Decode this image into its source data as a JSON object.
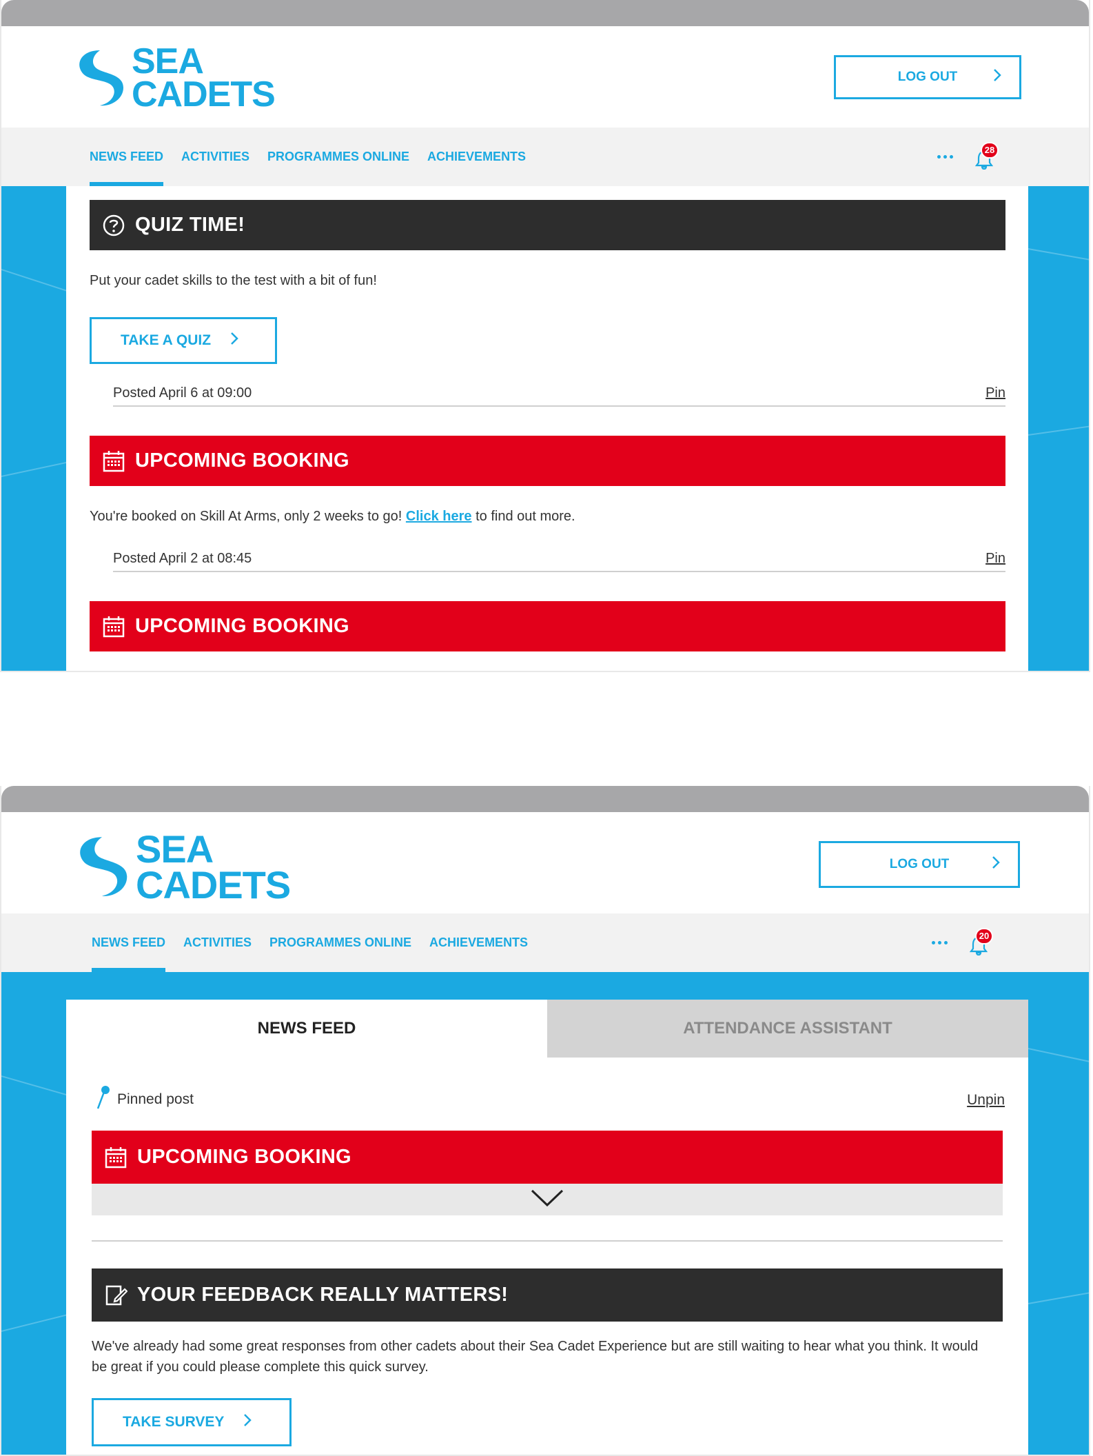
{
  "brand": {
    "line1": "SEA",
    "line2": "CADETS",
    "logo_icon": "sea-cadets-wave-logo",
    "color": "#1ba9e1"
  },
  "header": {
    "logout_label": "LOG OUT"
  },
  "nav": {
    "items": [
      {
        "label": "NEWS FEED"
      },
      {
        "label": "ACTIVITIES"
      },
      {
        "label": "PROGRAMMES ONLINE"
      },
      {
        "label": "ACHIEVEMENTS"
      }
    ],
    "more_icon": "ellipsis-icon",
    "bell_icon": "bell-icon"
  },
  "screen1": {
    "notification_count": "28",
    "quiz": {
      "title": "QUIZ TIME!",
      "icon": "question-circle-icon",
      "text": "Put your cadet skills to the test with a bit of fun!",
      "button": "TAKE A QUIZ",
      "posted": "Posted April 6 at 09:00",
      "pin": "Pin"
    },
    "booking1": {
      "title": "UPCOMING BOOKING",
      "icon": "calendar-icon",
      "text_before": "You're booked on Skill At Arms, only 2 weeks to go!",
      "link": "Click here",
      "text_after": "to find out more.",
      "posted": "Posted April 2 at 08:45",
      "pin": "Pin"
    },
    "booking2": {
      "title": "UPCOMING BOOKING",
      "icon": "calendar-icon"
    }
  },
  "screen2": {
    "notification_count": "20",
    "tabs": [
      {
        "label": "NEWS FEED"
      },
      {
        "label": "ATTENDANCE ASSISTANT"
      }
    ],
    "pinned": {
      "label": "Pinned post",
      "unpin": "Unpin",
      "icon": "pin-icon"
    },
    "booking": {
      "title": "UPCOMING BOOKING",
      "icon": "calendar-icon",
      "expand_icon": "chevron-down-icon"
    },
    "feedback": {
      "title": "YOUR FEEDBACK REALLY MATTERS!",
      "icon": "edit-form-icon",
      "text": "We've already had some great responses from other cadets about their Sea Cadet Experience but are still waiting to hear what you think. It would be great if you could please complete this quick survey.",
      "button": "TAKE SURVEY"
    }
  },
  "colors": {
    "accent": "#1ba9e1",
    "red": "#e2001a",
    "dark": "#2d2d2d"
  }
}
